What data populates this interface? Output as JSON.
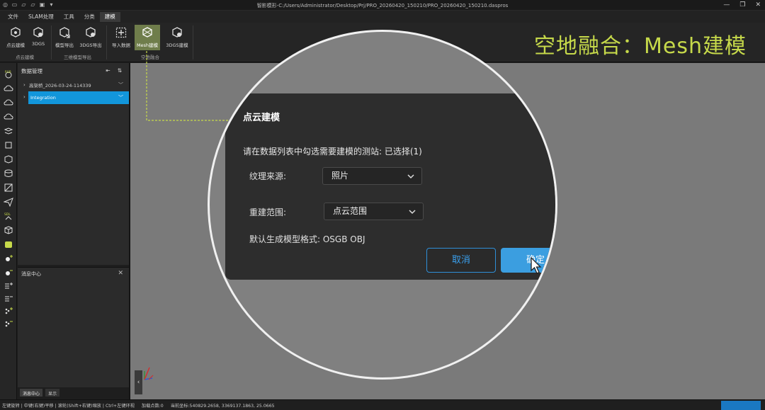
{
  "titlebar": {
    "title": "智影模形-C:/Users/Administrator/Desktop/Prj/PRO_20260420_150210/PRO_20260420_150210.daspros"
  },
  "menu": [
    {
      "label": "文件"
    },
    {
      "label": "SLAM处理"
    },
    {
      "label": "工具"
    },
    {
      "label": "分类"
    },
    {
      "label": "建模"
    }
  ],
  "ribbon": {
    "buttons": [
      {
        "label": "点云建模"
      },
      {
        "label": "3DGS"
      },
      {
        "label": "模型导出"
      },
      {
        "label": "3DGS导出"
      },
      {
        "label": "导入数据"
      },
      {
        "label": "Mesh建模"
      },
      {
        "label": "3DGS建模"
      }
    ],
    "groups": [
      {
        "label": "点云建模"
      },
      {
        "label": "三维模型导出"
      },
      {
        "label": "空地融合"
      }
    ]
  },
  "overlay_caption": "空地融合：Mesh建模",
  "data_panel": {
    "title": "数据管理",
    "items": [
      {
        "label": "高架桥_2026-03-24-114339"
      },
      {
        "label": "Integration"
      }
    ]
  },
  "message_panel": {
    "title": "消息中心"
  },
  "bottom_tabs": [
    {
      "label": "消息中心"
    },
    {
      "label": "显示"
    }
  ],
  "statusbar": {
    "hint": "左键旋转 | 中键(右键)平移 | 滚轮(Shift+右键)缩放 | Ctrl+左键环视",
    "points": "加载点数:0",
    "coords": "当前坐标:540829.2658, 3369137.1863, 25.0665"
  },
  "dialog": {
    "title": "点云建模",
    "prompt": "请在数据列表中勾选需要建模的测站: 已选择(1)",
    "texture_label": "纹理来源:",
    "texture_value": "照片",
    "range_label": "重建范围:",
    "range_value": "点云范围",
    "format_text": "默认生成模型格式: OSGB OBJ",
    "cancel_label": "取消",
    "ok_label": "确定"
  },
  "colors": {
    "accent": "#1296db",
    "caption": "#c6d94a",
    "selected_ribbon": "#6f7d4b",
    "callout": "#c6d94a"
  }
}
